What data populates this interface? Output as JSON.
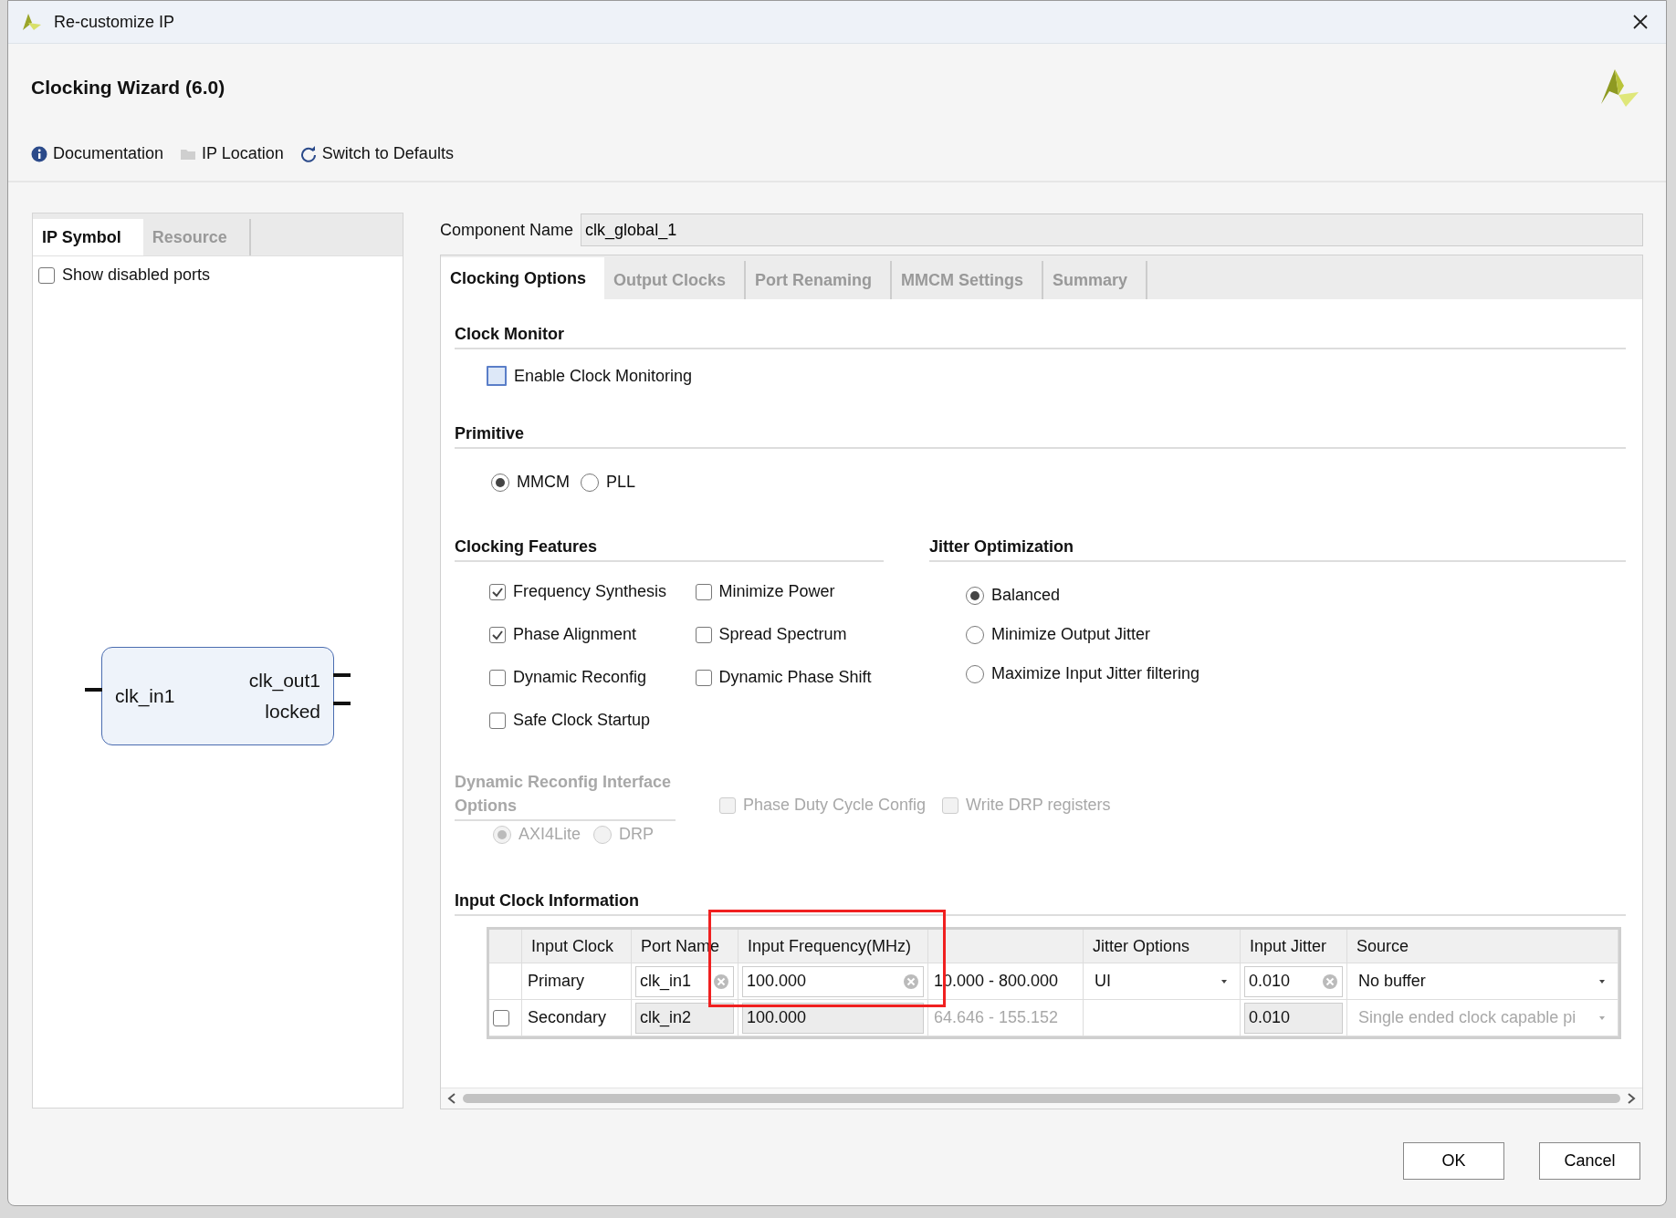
{
  "window": {
    "title": "Re-customize IP"
  },
  "header": {
    "title": "Clocking Wizard (6.0)"
  },
  "toolbar": [
    {
      "kind": "info",
      "label": "Documentation"
    },
    {
      "kind": "folder",
      "label": "IP Location"
    },
    {
      "kind": "refresh",
      "label": "Switch to Defaults"
    }
  ],
  "left_panel": {
    "tabs": [
      {
        "label": "IP Symbol",
        "selected": true
      },
      {
        "label": "Resource",
        "selected": false
      }
    ],
    "show_disabled_ports": {
      "label": "Show disabled ports",
      "checked": false
    },
    "symbol": {
      "inputs": [
        "clk_in1"
      ],
      "outputs": [
        "clk_out1",
        "locked"
      ]
    }
  },
  "component_name": {
    "label": "Component Name",
    "value": "clk_global_1"
  },
  "tabs": [
    {
      "label": "Clocking Options",
      "selected": true
    },
    {
      "label": "Output Clocks",
      "selected": false
    },
    {
      "label": "Port Renaming",
      "selected": false
    },
    {
      "label": "MMCM Settings",
      "selected": false
    },
    {
      "label": "Summary",
      "selected": false
    }
  ],
  "clock_monitor": {
    "title": "Clock Monitor",
    "options": [
      {
        "label": "Enable Clock Monitoring",
        "checked": false,
        "focused": true
      }
    ]
  },
  "primitive": {
    "title": "Primitive",
    "options": [
      {
        "label": "MMCM",
        "selected": true
      },
      {
        "label": "PLL",
        "selected": false
      }
    ]
  },
  "clocking_features": {
    "title": "Clocking Features",
    "options": [
      {
        "label": "Frequency Synthesis",
        "checked": true
      },
      {
        "label": "Minimize Power",
        "checked": false
      },
      {
        "label": "Phase Alignment",
        "checked": true
      },
      {
        "label": "Spread Spectrum",
        "checked": false
      },
      {
        "label": "Dynamic Reconfig",
        "checked": false
      },
      {
        "label": "Dynamic Phase Shift",
        "checked": false
      },
      {
        "label": "Safe Clock Startup",
        "checked": false
      }
    ]
  },
  "jitter_optimization": {
    "title": "Jitter Optimization",
    "options": [
      {
        "label": "Balanced",
        "selected": true
      },
      {
        "label": "Minimize Output Jitter",
        "selected": false
      },
      {
        "label": "Maximize Input Jitter filtering",
        "selected": false
      }
    ]
  },
  "dynamic_reconfig": {
    "title": "Dynamic Reconfig Interface Options",
    "disabled": true,
    "interface": [
      {
        "label": "AXI4Lite",
        "selected": true
      },
      {
        "label": "DRP",
        "selected": false
      }
    ],
    "options": [
      {
        "label": "Phase Duty Cycle Config",
        "checked": false
      },
      {
        "label": "Write DRP registers",
        "checked": false
      }
    ]
  },
  "input_clock": {
    "title": "Input Clock Information",
    "columns": [
      "Input Clock",
      "Port Name",
      "Input Frequency(MHz)",
      "Jitter Options",
      "Input Jitter",
      "Source"
    ],
    "rows": [
      {
        "input_clock": "Primary",
        "port_name": "clk_in1",
        "frequency": "100.000",
        "range": "10.000 - 800.000",
        "jitter_option": "UI",
        "input_jitter": "0.010",
        "source": "No buffer",
        "editable": true
      },
      {
        "checked": false,
        "input_clock": "Secondary",
        "port_name": "clk_in2",
        "frequency": "100.000",
        "range": "64.646 - 155.152",
        "input_jitter": "0.010",
        "source": "Single ended clock capable pi",
        "editable": false
      }
    ]
  },
  "buttons": [
    "OK",
    "Cancel"
  ]
}
